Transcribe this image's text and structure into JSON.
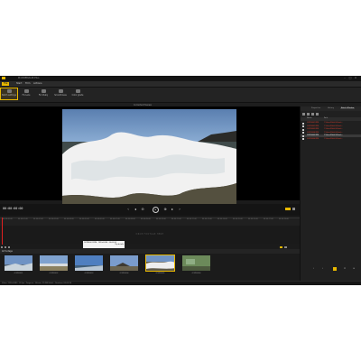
{
  "window": {
    "title": "ProDRENALIN Plus"
  },
  "menu": [
    "File",
    "Start",
    "Trim",
    "Actions"
  ],
  "ribbon": [
    {
      "label": "Batch settings",
      "icon": "gear-icon"
    },
    {
      "label": "Fix Lens",
      "icon": "lens-icon"
    },
    {
      "label": "Fix Shaky",
      "icon": "stabilize-icon"
    },
    {
      "label": "Smoothness",
      "icon": "smooth-icon"
    },
    {
      "label": "Color grade",
      "icon": "palette-icon"
    }
  ],
  "preview": {
    "tab_label": "Corrected Preview"
  },
  "transport": {
    "timecode": "00:00:00:00",
    "buttons": [
      "skip-back-icon",
      "rewind-icon",
      "play-icon",
      "forward-icon",
      "skip-forward-icon"
    ]
  },
  "timeline": {
    "ticks": [
      "00:00:00:00",
      "00:00:01:00",
      "00:00:02:00",
      "00:00:03:00",
      "00:00:04:00",
      "00:00:05:00",
      "00:00:06:00",
      "00:00:07:00",
      "00:00:08:00",
      "00:00:09:00",
      "00:00:10:00",
      "00:00:11:00",
      "00:00:12:00",
      "00:00:13:00",
      "00:00:14:00",
      "00:00:15:00",
      "00:00:16:00",
      "00:00:17:00",
      "00:00:18:00"
    ],
    "hint": "DROP FOOTAGE HERE",
    "tooltip": "GOPR0001.MP4 · 1920x1080 · 00:00:24",
    "tooltip_sub": "Clip details"
  },
  "clips": {
    "group_label": "All footage",
    "items": [
      {
        "name": "GOPR0001",
        "selected": false
      },
      {
        "name": "GOPR0002",
        "selected": false
      },
      {
        "name": "GOPR0003",
        "selected": false
      },
      {
        "name": "GOPR0004",
        "selected": false
      },
      {
        "name": "GOPR0005",
        "selected": true
      },
      {
        "name": "GOPR0006",
        "selected": false
      }
    ]
  },
  "status": "Video: 1920x1080 · 30 fps · Progress: · Bitrate: 29,988 kbit/s · Duration: 00:00:24",
  "sidepanel": {
    "tabs": [
      "Properties",
      "History",
      "Batch Window"
    ],
    "active_tab": "Batch Window",
    "columns": [
      "Name",
      "Path"
    ],
    "rows": [
      {
        "file": "GOPR0001.MP4",
        "path": "C:\\Users\\Public\\Videos\\...",
        "selected": false
      },
      {
        "file": "GOPR0002.MP4",
        "path": "C:\\Users\\Public\\Videos\\...",
        "selected": false
      },
      {
        "file": "GOPR0003.MP4",
        "path": "C:\\Users\\Public\\Videos\\...",
        "selected": false
      },
      {
        "file": "GOPR0004.MP4",
        "path": "C:\\Users\\Public\\Videos\\...",
        "selected": false
      },
      {
        "file": "GOPR0005.MP4",
        "path": "C:\\Users\\Public\\Videos\\...",
        "selected": true
      },
      {
        "file": "GOPR0006.MP4",
        "path": "C:\\Users\\Public\\Videos\\...",
        "selected": false
      }
    ]
  },
  "colors": {
    "accent": "#e8b800",
    "error_text": "#e04030",
    "background": "#1b1b1b"
  }
}
